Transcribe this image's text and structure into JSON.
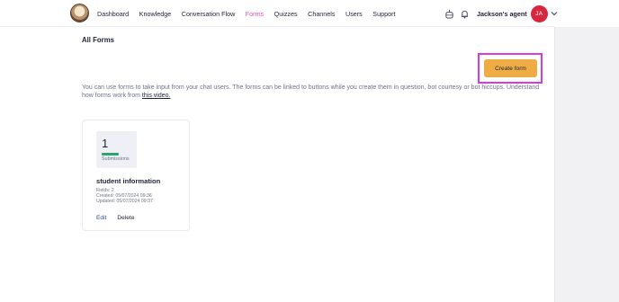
{
  "nav": {
    "logo": "owl-logo",
    "items": [
      {
        "label": "Dashboard"
      },
      {
        "label": "Knowledge"
      },
      {
        "label": "Conversation Flow"
      },
      {
        "label": "Forms",
        "active": true
      },
      {
        "label": "Quizzes"
      },
      {
        "label": "Channels"
      },
      {
        "label": "Users"
      },
      {
        "label": "Support"
      }
    ],
    "active_color": "#e24eb3",
    "agent_name": "Jackson's agent",
    "avatar_initials": "JA",
    "avatar_color": "#d7263d"
  },
  "page": {
    "title": "All Forms",
    "create_button": "Create form",
    "create_button_color": "#efac45",
    "highlight_color": "#d63be0",
    "description": "You can use forms to take input from your chat users. The forms can be linked to buttons while you create them in question, bot courtesy or bot hiccups. Understand how forms work from",
    "description_link": "this video."
  },
  "forms": [
    {
      "submissions": "1",
      "submissions_label": "Submissions",
      "name": "student information",
      "fields": "Fields: 2",
      "created": "Created: 05/07/2024 09:36",
      "updated": "Updated: 05/07/2024 09:37",
      "edit_label": "Edit",
      "delete_label": "Delete"
    }
  ]
}
